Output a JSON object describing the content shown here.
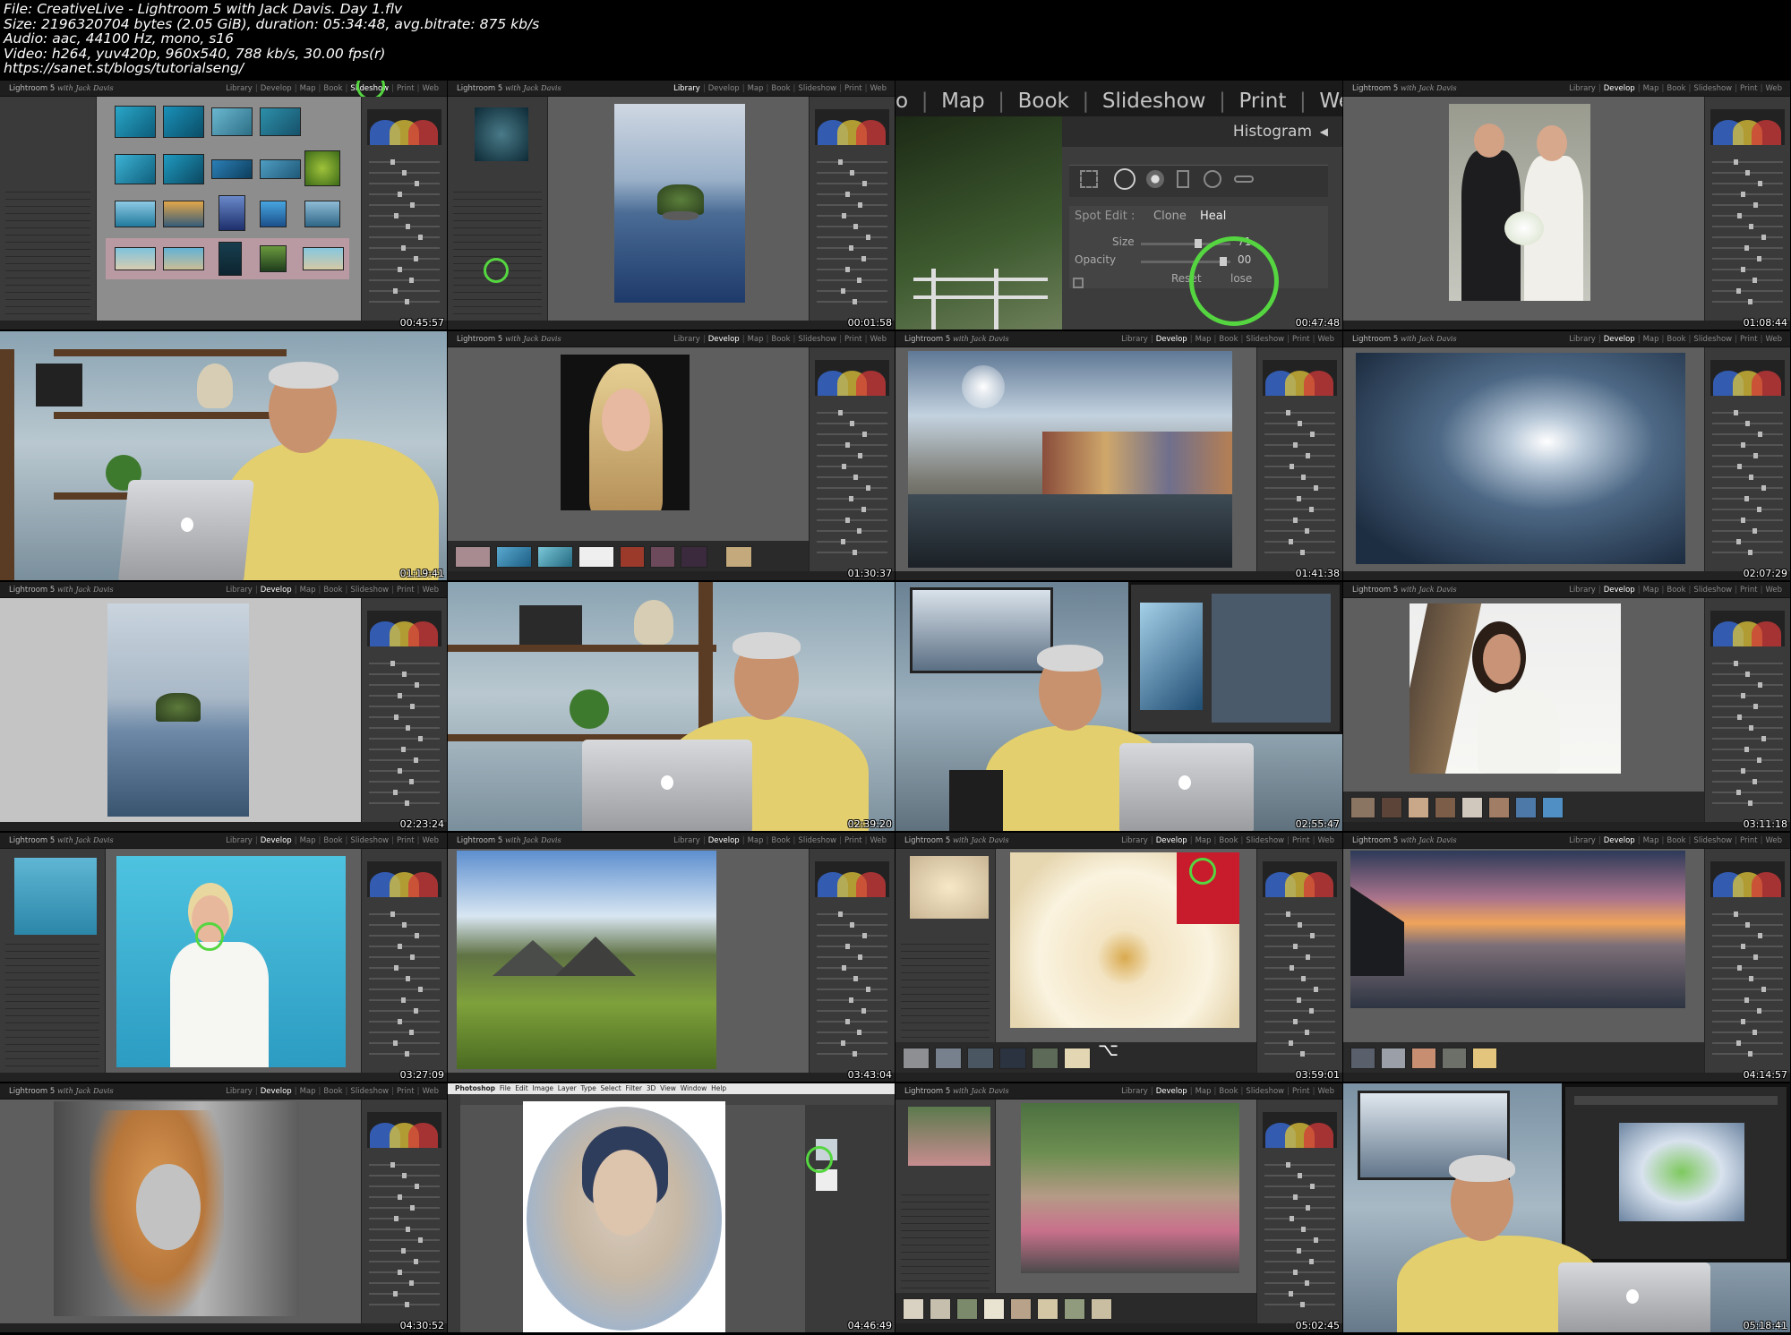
{
  "header": {
    "file": "File: CreativeLive - Lightroom 5 with Jack Davis. Day 1.flv",
    "size": "Size: 2196320704 bytes (2.05 GiB), duration: 05:34:48, avg.bitrate: 875 kb/s",
    "audio": "Audio: aac, 44100 Hz, mono, s16",
    "video": "Video: h264, yuv420p, 960x540, 788 kb/s, 30.00 fps(r)",
    "url": "https://sanet.st/blogs/tutorialseng/"
  },
  "lightroom": {
    "brand": "Lightroom 5",
    "brand_sub": "with Jack Davis",
    "modules": [
      "Library",
      "Develop",
      "Map",
      "Book",
      "Slideshow",
      "Print",
      "Web"
    ]
  },
  "zoom_panel": {
    "modules": [
      "o",
      "Map",
      "Book",
      "Slideshow",
      "Print",
      "Web"
    ],
    "histogram": "Histogram",
    "spot_edit": "Spot Edit :",
    "clone": "Clone",
    "heal": "Heal",
    "size_label": "Size",
    "size_value": "71",
    "opacity_label": "Opacity",
    "opacity_value": "00",
    "reset": "Reset",
    "close": "lose"
  },
  "photoshop_menu": [
    "Photoshop",
    "File",
    "Edit",
    "Image",
    "Layer",
    "Type",
    "Select",
    "Filter",
    "3D",
    "View",
    "Window",
    "Help"
  ],
  "timestamps": [
    "00:45:57",
    "00:01:58",
    "00:47:48",
    "01:08:44",
    "01:19:41",
    "01:30:37",
    "01:41:38",
    "02:07:29",
    "02:23:24",
    "02:39:20",
    "02:55:47",
    "03:11:18",
    "03:27:09",
    "03:43:04",
    "03:59:01",
    "04:14:57",
    "04:30:52",
    "04:46:49",
    "05:02:45",
    "05:18:41"
  ],
  "active_module": [
    "Slideshow",
    "Library",
    "",
    "Develop",
    "",
    "Develop",
    "Develop",
    "Develop",
    "Develop",
    "",
    "",
    "Develop",
    "Develop",
    "Develop",
    "Develop",
    "Develop",
    "Develop",
    "",
    "Develop",
    ""
  ],
  "colors": {
    "highlight_circle": "#55d640",
    "panel": "#3a3a3a",
    "background": "#000000"
  }
}
